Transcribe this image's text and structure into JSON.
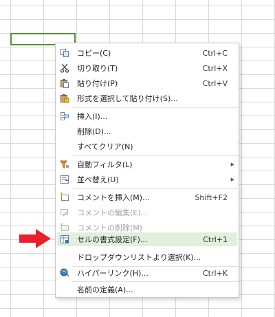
{
  "menu": {
    "items": [
      {
        "label": "コピー(C)",
        "shortcut": "Ctrl+C",
        "icon": "copy-icon"
      },
      {
        "label": "切り取り(T)",
        "shortcut": "Ctrl+X",
        "icon": "scissors-icon"
      },
      {
        "label": "貼り付け(P)",
        "shortcut": "Ctrl+V",
        "icon": "paste-icon"
      },
      {
        "label": "形式を選択して貼り付け(S)...",
        "shortcut": "",
        "icon": "paste-special-icon"
      },
      {
        "label": "挿入(I)...",
        "shortcut": "",
        "icon": "insert-icon"
      },
      {
        "label": "削除(D)...",
        "shortcut": ""
      },
      {
        "label": "すべてクリア(N)",
        "shortcut": ""
      },
      {
        "label": "自動フィルタ(L)",
        "shortcut": "",
        "icon": "autofilter-icon",
        "submenu": true
      },
      {
        "label": "並べ替え(U)",
        "shortcut": "",
        "icon": "sort-icon",
        "submenu": true
      },
      {
        "label": "コメントを挿入(M)...",
        "shortcut": "Shift+F2",
        "icon": "comment-insert-icon"
      },
      {
        "label": "コメントの編集(E)...",
        "shortcut": "",
        "icon": "comment-edit-icon",
        "disabled": true
      },
      {
        "label": "コメントの削除(M)",
        "shortcut": "",
        "icon": "comment-delete-icon",
        "disabled": true
      },
      {
        "label": "セルの書式設定(F)...",
        "shortcut": "Ctrl+1",
        "icon": "format-cells-icon",
        "highlighted": true
      },
      {
        "label": "ドロップダウンリストより選択(K)...",
        "shortcut": ""
      },
      {
        "label": "ハイパーリンク(H)...",
        "shortcut": "Ctrl+K",
        "icon": "hyperlink-icon"
      },
      {
        "label": "名前の定義(A)...",
        "shortcut": ""
      }
    ]
  },
  "colors": {
    "highlight": "#e2efda",
    "selection_border": "#4e9a2f",
    "arrow": "#e8202a"
  }
}
